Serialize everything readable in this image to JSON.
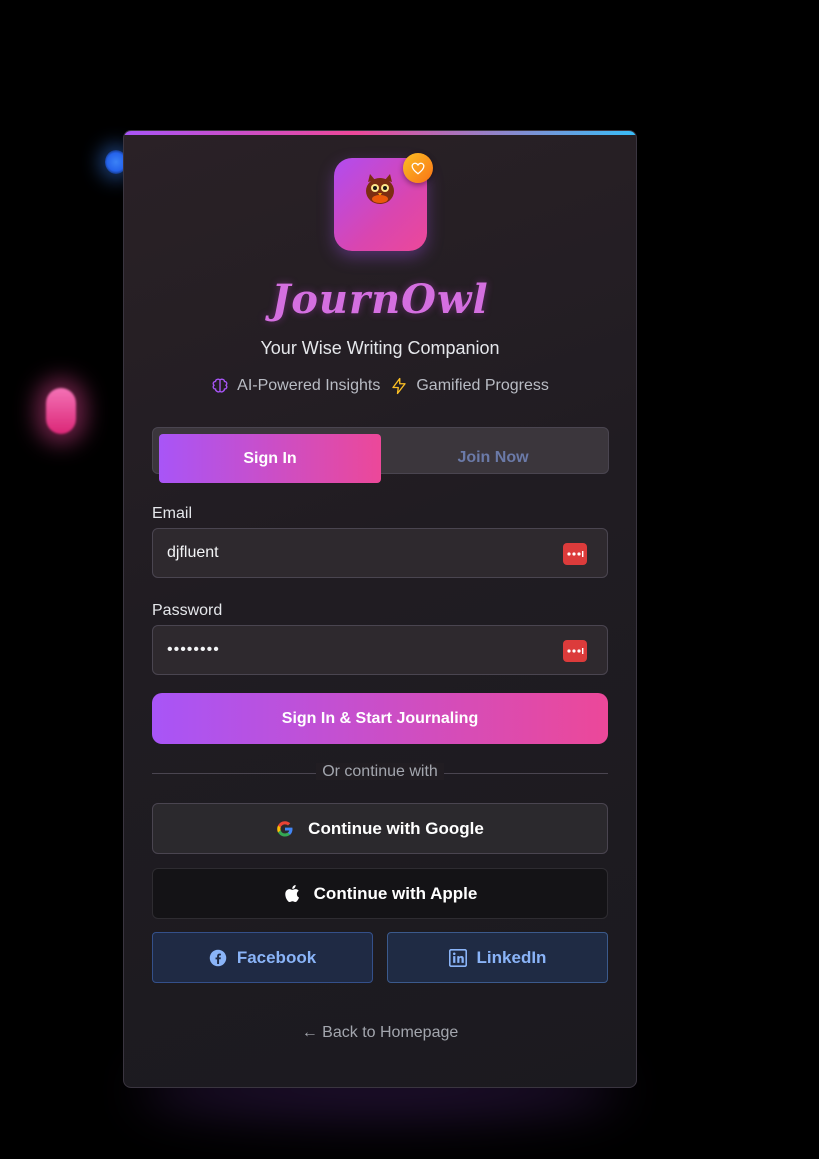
{
  "app": {
    "brand_name": "JournOwl",
    "tagline": "Your Wise Writing Companion"
  },
  "features": [
    {
      "label": "AI-Powered Insights",
      "icon": "brain-icon",
      "color": "#a855f7"
    },
    {
      "label": "Gamified Progress",
      "icon": "lightning-icon",
      "color": "#fbbf24"
    }
  ],
  "tabs": {
    "active": "Sign In",
    "inactive": "Join Now"
  },
  "form": {
    "email_label": "Email",
    "email_value": "djfluent",
    "password_label": "Password",
    "password_value": "••••••••",
    "submit_label": "Sign In & Start Journaling"
  },
  "divider": "Or continue with",
  "social": {
    "google": "Continue with Google",
    "apple": "Continue with Apple",
    "facebook": "Facebook",
    "linkedin": "LinkedIn"
  },
  "back_link": "← Back to Homepage",
  "colors": {
    "accent_start": "#a855f7",
    "accent_end": "#ec4899",
    "background": "#000000",
    "badge": "#f97316",
    "password_manager": "#dc3b3b"
  }
}
